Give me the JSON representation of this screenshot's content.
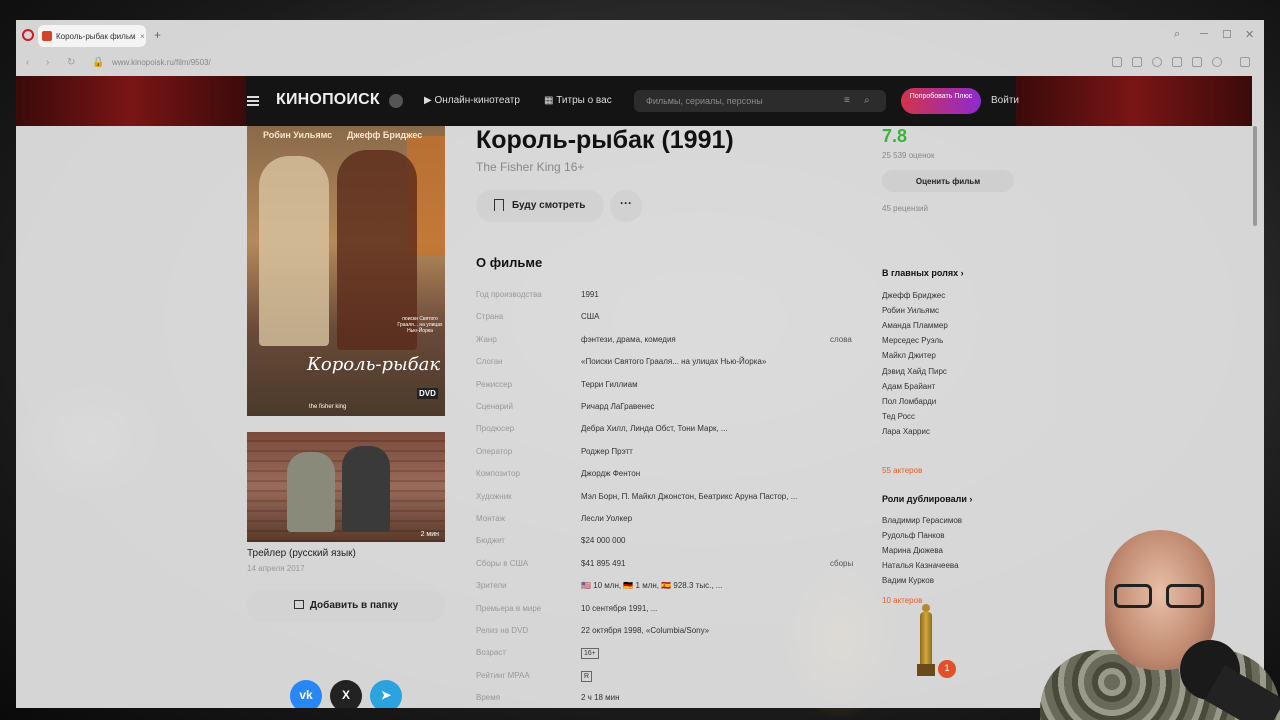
{
  "browser": {
    "tab_title": "Король-рыбак фильм",
    "tab_close": "×",
    "new_tab": "+",
    "url": "www.kinopoisk.ru/film/9503/"
  },
  "site": {
    "logo": "КИНОПОИСК",
    "nav_online": "Онлайн-кинотеатр",
    "nav_titles": "Титры о вас",
    "search_placeholder": "Фильмы, сериалы, персоны",
    "try_plus": "Попробовать Плюс",
    "login": "Войти"
  },
  "poster": {
    "actor1": "Робин Уильямс",
    "actor2": "Джефф Бриджес",
    "title_art": "Король-рыбак",
    "subtitle": "the fisher king",
    "tagline": "поиски Святого Грааля... на улицах Нью-Йорка",
    "dvd": "DVD"
  },
  "trailer": {
    "duration": "2 мин",
    "title": "Трейлер (русский язык)",
    "date": "14 апреля 2017"
  },
  "add_to_folder": "Добавить в папку",
  "social": {
    "vk": "vk",
    "x": "X",
    "tg": "➤"
  },
  "movie": {
    "title": "Король-рыбак (1991)",
    "original": "The Fisher King  16+",
    "watch_later": "Буду смотреть",
    "more": "···",
    "about_heading": "О фильме"
  },
  "facts": [
    {
      "label": "Год производства",
      "value": "1991",
      "extra": ""
    },
    {
      "label": "Страна",
      "value": "США",
      "extra": ""
    },
    {
      "label": "Жанр",
      "value": "фэнтези, драма, комедия",
      "extra": "слова"
    },
    {
      "label": "Слоган",
      "value": "«Поиски Святого Грааля... на улицах Нью-Йорка»",
      "extra": ""
    },
    {
      "label": "Режиссер",
      "value": "Терри Гиллиам",
      "extra": ""
    },
    {
      "label": "Сценарий",
      "value": "Ричард ЛаГравенес",
      "extra": ""
    },
    {
      "label": "Продюсер",
      "value": "Дебра Хилл, Линда Обст, Тони Марк, ...",
      "extra": ""
    },
    {
      "label": "Оператор",
      "value": "Роджер Прэтт",
      "extra": ""
    },
    {
      "label": "Композитор",
      "value": "Джордж Фентон",
      "extra": ""
    },
    {
      "label": "Художник",
      "value": "Мэл Борн, П. Майкл Джонстон, Беатрикс Аруна Пастор, ...",
      "extra": ""
    },
    {
      "label": "Монтаж",
      "value": "Лесли Уолкер",
      "extra": ""
    },
    {
      "label": "Бюджет",
      "value": "$24 000 000",
      "extra": ""
    },
    {
      "label": "Сборы в США",
      "value": "$41 895 491",
      "extra": "сборы"
    },
    {
      "label": "Зрители",
      "value": "🇺🇸 10 млн, 🇩🇪 1 млн, 🇪🇸 928.3 тыс., ...",
      "extra": ""
    },
    {
      "label": "Премьера в мире",
      "value": "10 сентября 1991, ...",
      "extra": ""
    },
    {
      "label": "Релиз на DVD",
      "value": "22 октября 1998, «Columbia/Sony»",
      "extra": ""
    },
    {
      "label": "Возраст",
      "value": "16+",
      "extra": ""
    },
    {
      "label": "Рейтинг MPAA",
      "value": "R",
      "extra": ""
    },
    {
      "label": "Время",
      "value": "2 ч 18 мин",
      "extra": ""
    }
  ],
  "rating": {
    "score": "7.8",
    "votes": "25 539 оценок",
    "rate_button": "Оценить фильм",
    "reviews": "45 рецензий"
  },
  "cast": {
    "heading": "В главных ролях",
    "actors": [
      "Джефф Бриджес",
      "Робин Уильямс",
      "Аманда Пламмер",
      "Мерседес Руэль",
      "Майкл Джитер",
      "Дэвид Хайд Пирс",
      "Адам Брайант",
      "Пол Ломбарди",
      "Тед Росс",
      "Лара Харрис"
    ],
    "more": "55 актеров"
  },
  "dubbing": {
    "heading": "Роли дублировали",
    "actors": [
      "Владимир Герасимов",
      "Рудольф Панков",
      "Марина Дюжева",
      "Наталья Казначеева",
      "Вадим Курков"
    ],
    "more": "10 актеров"
  },
  "oscar_count": "1"
}
